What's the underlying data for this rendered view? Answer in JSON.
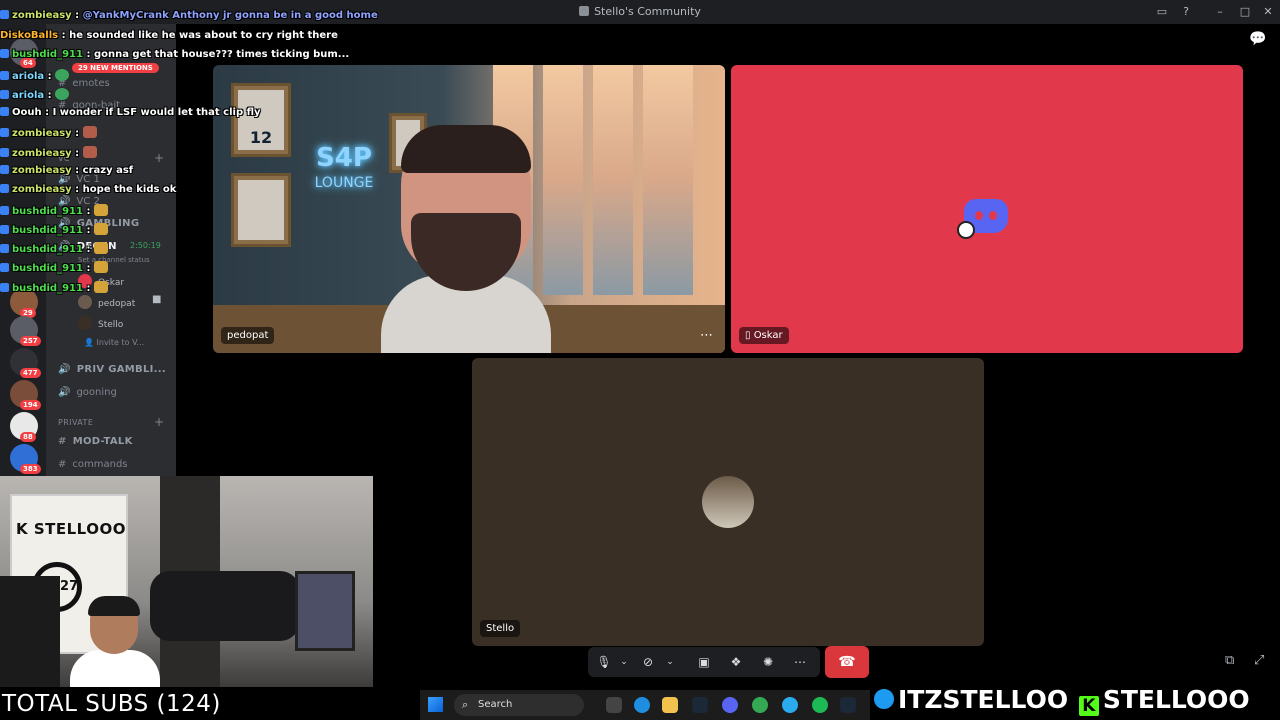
{
  "window": {
    "title": "Stello's Community"
  },
  "sidebar": {
    "new_mentions": "29 NEW MENTIONS",
    "channels": [
      {
        "label": "emotes"
      },
      {
        "label": "goon-bait"
      }
    ],
    "voice_category": "VC",
    "voice_channels": [
      {
        "label": "VC 1"
      },
      {
        "label": "VC 2"
      },
      {
        "label": "GAMBLING"
      }
    ],
    "active_voice": {
      "label": "DEGEN",
      "timer": "2:50:19",
      "status": "Set a channel status"
    },
    "voice_users": [
      {
        "label": "Oskar"
      },
      {
        "label": "pedopat"
      },
      {
        "label": "Stello"
      }
    ],
    "invite": "Invite to V...",
    "more_voice": [
      {
        "label": "PRIV GAMBLI..."
      },
      {
        "label": "gooning"
      }
    ],
    "private_category": "PRIVATE",
    "private_channels": [
      {
        "label": "MOD-TALK"
      },
      {
        "label": "commands"
      }
    ],
    "server_badges": [
      "64",
      "29",
      "257",
      "477",
      "194",
      "88",
      "383"
    ]
  },
  "tiles": {
    "pedopat": {
      "name": "pedopat",
      "neon_top": "S4P",
      "neon_bottom": "LOUNGE",
      "jersey": "12"
    },
    "oskar": {
      "name": "Oskar",
      "bg": "#e2384c"
    },
    "stello": {
      "name": "Stello",
      "bg": "#3a2f24"
    }
  },
  "chat": [
    {
      "user": "zombieasy",
      "color": "#c9e26a",
      "text": "@YankMyCrank Anthony jr gonna be in a good home",
      "user_color_text": "#8ea3ff"
    },
    {
      "user": "DiskoBalls",
      "color": "#ffb52b",
      "text": "he sounded like he was about to cry right there"
    },
    {
      "user": "bushdid_911",
      "color": "#4ddd4d",
      "text": "gonna get that house??? times ticking bum..."
    },
    {
      "user": "ariola",
      "color": "#7fd8ff",
      "text": ""
    },
    {
      "user": "ariola",
      "color": "#7fd8ff",
      "text": ""
    },
    {
      "user": "Oouh",
      "color": "#ffffff",
      "text": "I wonder if LSF would let that clip fly"
    },
    {
      "user": "zombieasy",
      "color": "#c9e26a",
      "text": ""
    },
    {
      "user": "zombieasy",
      "color": "#c9e26a",
      "text": ""
    },
    {
      "user": "zombieasy",
      "color": "#c9e26a",
      "text": "crazy asf"
    },
    {
      "user": "zombieasy",
      "color": "#c9e26a",
      "text": "hope the kids ok"
    },
    {
      "user": "bushdid_911",
      "color": "#4ddd4d",
      "text": ""
    },
    {
      "user": "bushdid_911",
      "color": "#4ddd4d",
      "text": ""
    },
    {
      "user": "bushdid_911",
      "color": "#4ddd4d",
      "text": ""
    },
    {
      "user": "bushdid_911",
      "color": "#4ddd4d",
      "text": ""
    },
    {
      "user": "bushdid_911",
      "color": "#4ddd4d",
      "text": ""
    }
  ],
  "webcam": {
    "box_brand": "K STELLOOO",
    "box_seal": "11.27"
  },
  "footer": {
    "subs": "TOTAL SUBS (124)",
    "twitter": "ITZSTELLOO",
    "kick": "STELLOOO",
    "kick_icon": "K",
    "search_placeholder": "Search"
  },
  "colors": {
    "accent": "#5865f2",
    "hangup": "#da373c",
    "oskar_bg": "#e2384c"
  },
  "icons": [
    "inbox-icon",
    "help-icon",
    "minimize-icon",
    "maximize-icon",
    "close-icon",
    "microphone-icon",
    "camera-off-icon",
    "screen-share-icon",
    "activities-icon",
    "soundboard-icon",
    "more-icon",
    "hang-up-icon",
    "popout-icon",
    "fullscreen-icon",
    "chat-icon"
  ]
}
